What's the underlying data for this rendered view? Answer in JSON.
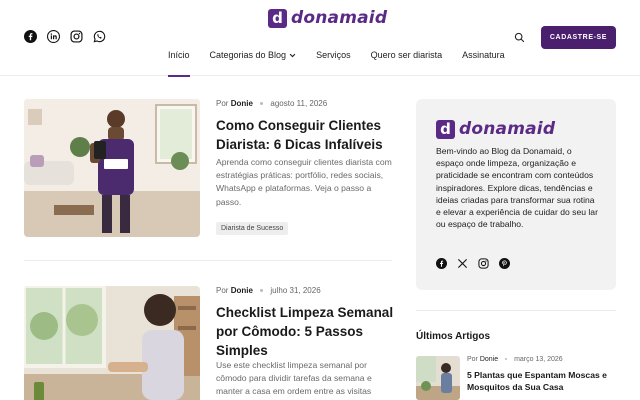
{
  "brand": {
    "name": "donamaid",
    "mark": "d",
    "color": "#5b2a86"
  },
  "header": {
    "socials": [
      "facebook-icon",
      "linkedin-icon",
      "instagram-icon",
      "whatsapp-icon"
    ],
    "nav": [
      {
        "label": "Início",
        "active": true
      },
      {
        "label": "Categorias do Blog",
        "dropdown": true
      },
      {
        "label": "Serviços"
      },
      {
        "label": "Quero ser diarista"
      },
      {
        "label": "Assinatura"
      }
    ],
    "cta_label": "CADASTRE-SE",
    "cta_color": "#4a1f6e"
  },
  "posts": [
    {
      "author_prefix": "Por",
      "author": "Donie",
      "date": "agosto 11, 2026",
      "title": "Como Conseguir Clientes Diarista: 6 Dicas Infalíveis",
      "excerpt": "Aprenda como conseguir clientes diarista com estratégias práticas: portfólio, redes sociais, WhatsApp e plataformas. Veja o passo a passo.",
      "tag": "Diarista de Sucesso"
    },
    {
      "author_prefix": "Por",
      "author": "Donie",
      "date": "julho 31, 2026",
      "title": "Checklist Limpeza Semanal por Cômodo: 5 Passos Simples",
      "excerpt": "Use este checklist limpeza semanal por cômodo para dividir tarefas da semana e manter a casa em ordem entre as visitas"
    }
  ],
  "sidebar": {
    "about_text": "Bem-vindo ao Blog da Donamaid, o espaço onde limpeza, organização e praticidade se encontram com conteúdos inspiradores. Explore dicas, tendências e ideias criadas para transformar sua rotina e elevar a experiência de cuidar do seu lar ou espaço de trabalho.",
    "socials": [
      "facebook-icon",
      "x-icon",
      "instagram-icon",
      "pinterest-icon"
    ],
    "latest_heading": "Últimos Artigos",
    "latest": [
      {
        "author_prefix": "Por",
        "author": "Donie",
        "date": "março 13, 2026",
        "title": "5 Plantas que Espantam Moscas e Mosquitos da Sua Casa"
      }
    ]
  }
}
